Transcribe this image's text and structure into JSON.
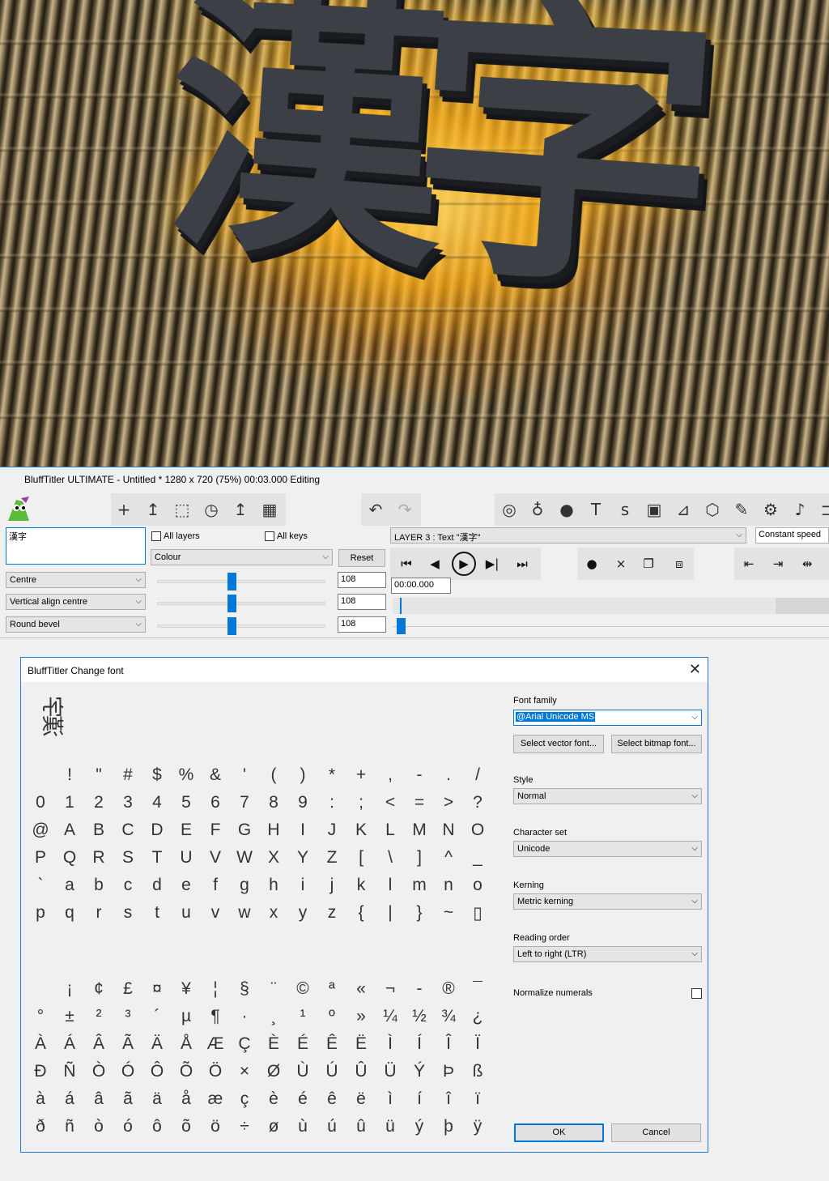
{
  "preview": {
    "title_text": "漢字"
  },
  "window": {
    "title": "BluffTitler ULTIMATE  - Untitled * 1280 x 720 (75%) 00:03.000 Editing"
  },
  "toolbar": {
    "group1": [
      "+",
      "↥",
      "⬚",
      "◷",
      "↥",
      "▦"
    ],
    "group2": [
      "↶",
      "↷"
    ],
    "group3": [
      "◎",
      "♁",
      "●",
      "T",
      "s",
      "▣",
      "⊿",
      "⬡",
      "✎",
      "⚙",
      "♪",
      "⊐"
    ]
  },
  "panel": {
    "text_value": "漢字",
    "all_layers_label": "All layers",
    "all_keys_label": "All keys",
    "property_select": "Colour",
    "reset_label": "Reset",
    "align_select": "Centre",
    "valign_select": "Vertical align centre",
    "bevel_select": "Round bevel",
    "value1": "108",
    "value2": "108",
    "value3": "108",
    "slider_levels": [
      0.44,
      0.44,
      0.44
    ]
  },
  "layer": {
    "select": "LAYER 3 : Text \"漢字\"",
    "speed_select": "Constant speed",
    "time": "00:00.000"
  },
  "transport": [
    "⏮",
    "◀",
    "▶",
    "▶|",
    "⏭"
  ],
  "key_controls": [
    "●",
    "×",
    "❐",
    "⧈"
  ],
  "align_controls": [
    "⇤",
    "⇥",
    "⇹"
  ],
  "dialog": {
    "title": "BluffTitler Change font",
    "close_label": "✕",
    "sample": "漢字",
    "font_family_label": "Font family",
    "font_family_value": "@Arial Unicode MS",
    "select_vector_label": "Select vector font...",
    "select_bitmap_label": "Select bitmap font...",
    "style_label": "Style",
    "style_value": "Normal",
    "charset_label": "Character set",
    "charset_value": "Unicode",
    "kerning_label": "Kerning",
    "kerning_value": "Metric kerning",
    "reading_label": "Reading order",
    "reading_value": "Left to right (LTR)",
    "normalize_label": "Normalize numerals",
    "ok_label": "OK",
    "cancel_label": "Cancel",
    "chars_rows": [
      [
        " ",
        "!",
        "\"",
        "#",
        "$",
        "%",
        "&",
        "'",
        "(",
        ")",
        "*",
        "+",
        ",",
        "-",
        ".",
        "/"
      ],
      [
        "0",
        "1",
        "2",
        "3",
        "4",
        "5",
        "6",
        "7",
        "8",
        "9",
        ":",
        ";",
        "<",
        "=",
        ">",
        "?"
      ],
      [
        "@",
        "A",
        "B",
        "C",
        "D",
        "E",
        "F",
        "G",
        "H",
        "I",
        "J",
        "K",
        "L",
        "M",
        "N",
        "O"
      ],
      [
        "P",
        "Q",
        "R",
        "S",
        "T",
        "U",
        "V",
        "W",
        "X",
        "Y",
        "Z",
        "[",
        "\\",
        "]",
        "^",
        "_"
      ],
      [
        "`",
        "a",
        "b",
        "c",
        "d",
        "e",
        "f",
        "g",
        "h",
        "i",
        "j",
        "k",
        "l",
        "m",
        "n",
        "o"
      ],
      [
        "p",
        "q",
        "r",
        "s",
        "t",
        "u",
        "v",
        "w",
        "x",
        "y",
        "z",
        "{",
        "|",
        "}",
        "~",
        "▯"
      ],
      [],
      [
        " ",
        "¡",
        "¢",
        "£",
        "¤",
        "¥",
        "¦",
        "§",
        "¨",
        "©",
        "ª",
        "«",
        "¬",
        "-",
        "®",
        "¯"
      ],
      [
        "°",
        "±",
        "²",
        "³",
        "´",
        "µ",
        "¶",
        "·",
        "¸",
        "¹",
        "º",
        "»",
        "¼",
        "½",
        "¾",
        "¿"
      ],
      [
        "À",
        "Á",
        "Â",
        "Ã",
        "Ä",
        "Å",
        "Æ",
        "Ç",
        "È",
        "É",
        "Ê",
        "Ë",
        "Ì",
        "Í",
        "Î",
        "Ï"
      ],
      [
        "Đ",
        "Ñ",
        "Ò",
        "Ó",
        "Ô",
        "Õ",
        "Ö",
        "×",
        "Ø",
        "Ù",
        "Ú",
        "Û",
        "Ü",
        "Ý",
        "Þ",
        "ß"
      ],
      [
        "à",
        "á",
        "â",
        "ã",
        "ä",
        "å",
        "æ",
        "ç",
        "è",
        "é",
        "ê",
        "ë",
        "ì",
        "í",
        "î",
        "ï"
      ],
      [
        "ð",
        "ñ",
        "ò",
        "ó",
        "ô",
        "õ",
        "ö",
        "÷",
        "ø",
        "ù",
        "ú",
        "û",
        "ü",
        "ý",
        "þ",
        "ÿ"
      ]
    ]
  }
}
